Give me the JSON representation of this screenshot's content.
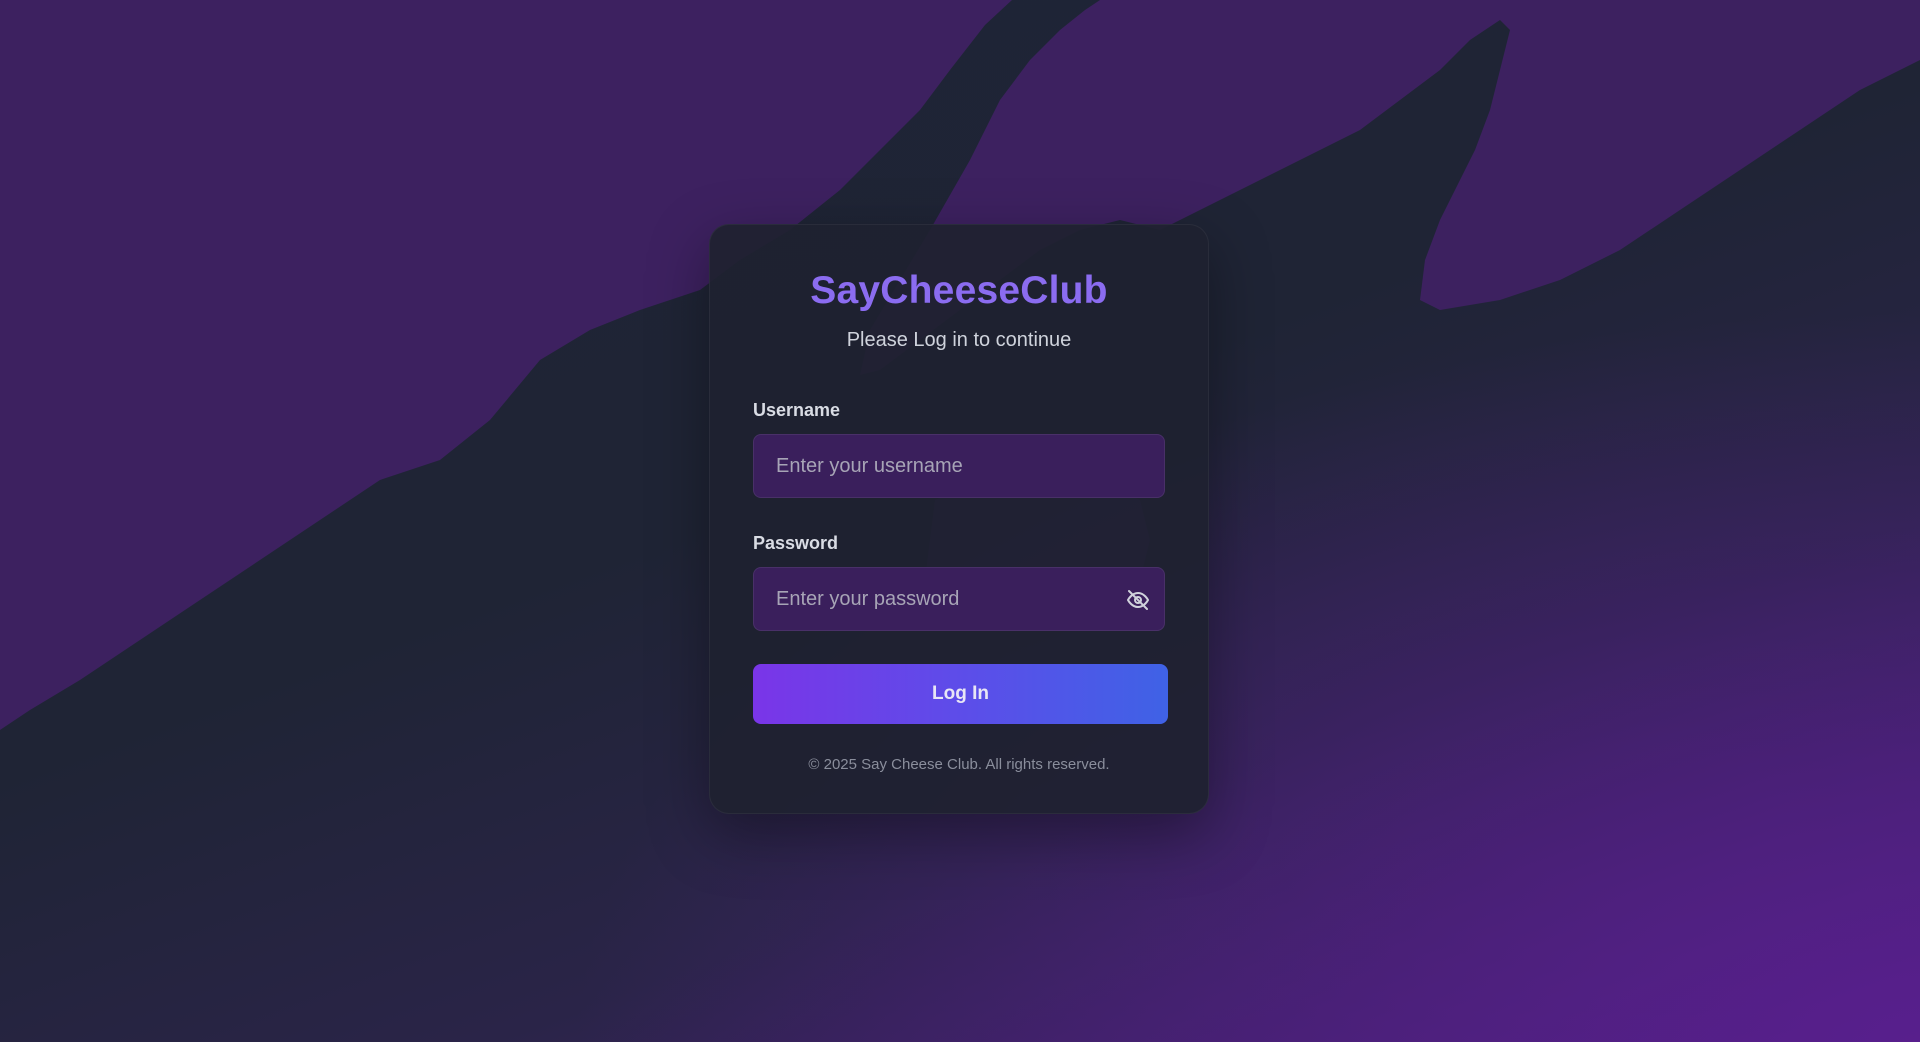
{
  "app": {
    "title": "SayCheeseClub",
    "subtitle": "Please Log in to continue"
  },
  "form": {
    "username_label": "Username",
    "username_placeholder": "Enter your username",
    "username_value": "",
    "password_label": "Password",
    "password_placeholder": "Enter your password",
    "password_value": "",
    "password_toggle_icon": "eye-off-icon",
    "submit_label": "Log In"
  },
  "footer": {
    "text": "© 2025 Say Cheese Club. All rights reserved."
  },
  "colors": {
    "accent_title": "#8b6cf0",
    "button_gradient_start": "#7a35e8",
    "button_gradient_end": "#3f62e6",
    "field_background": "#3a1f5c",
    "background_dark": "#1f2435",
    "background_purple": "#4a1f7a"
  }
}
